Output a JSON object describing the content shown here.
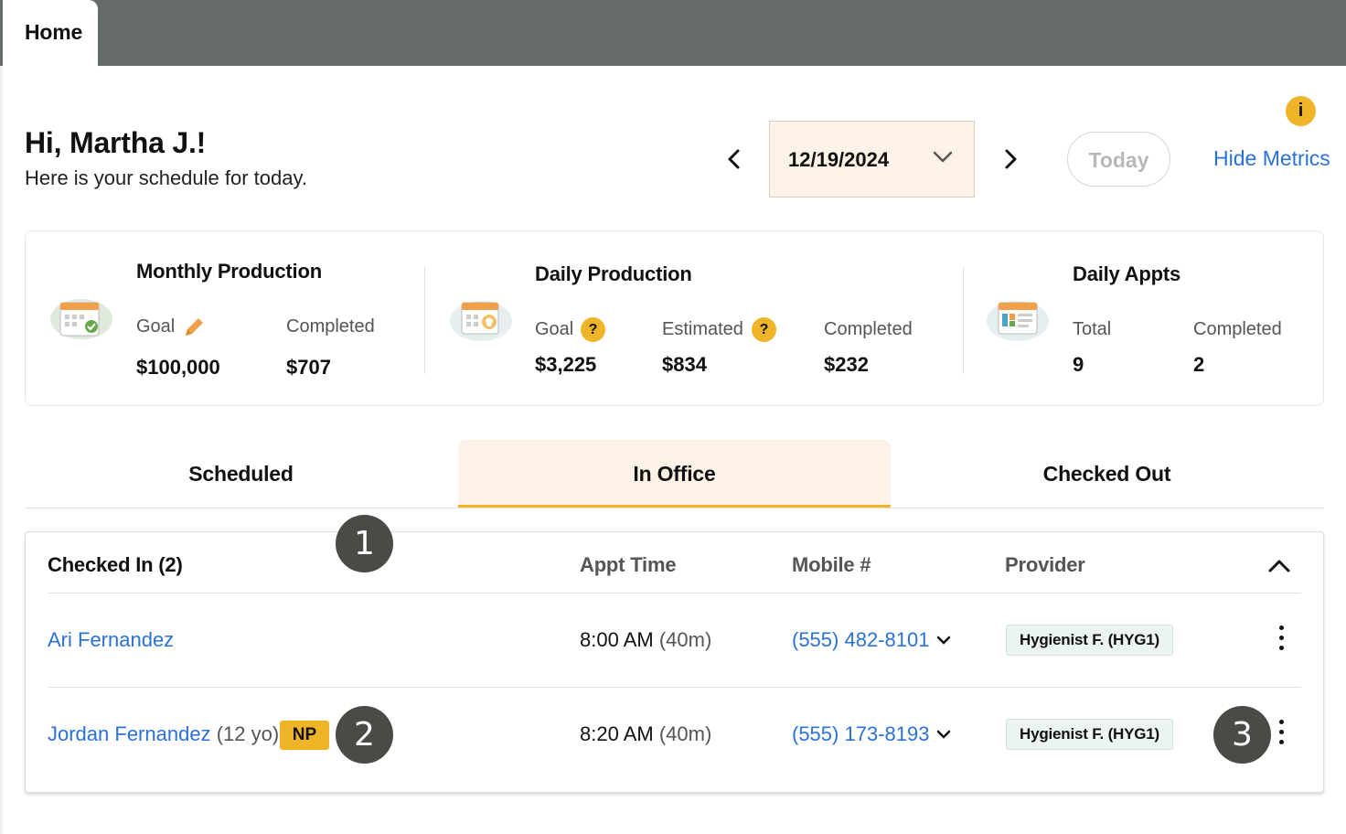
{
  "tabs": {
    "home": "Home"
  },
  "greeting": {
    "title": "Hi, Martha J.!",
    "subtitle": "Here is your schedule for today."
  },
  "date_nav": {
    "date": "12/19/2024",
    "today_label": "Today",
    "hide_metrics_label": "Hide Metrics",
    "info_glyph": "i"
  },
  "metrics": {
    "monthly": {
      "title": "Monthly Production",
      "goal_label": "Goal",
      "goal_value": "$100,000",
      "completed_label": "Completed",
      "completed_value": "$707"
    },
    "daily_production": {
      "title": "Daily Production",
      "goal_label": "Goal",
      "goal_value": "$3,225",
      "estimated_label": "Estimated",
      "estimated_value": "$834",
      "completed_label": "Completed",
      "completed_value": "$232",
      "help_glyph": "?"
    },
    "daily_appts": {
      "title": "Daily Appts",
      "total_label": "Total",
      "total_value": "9",
      "completed_label": "Completed",
      "completed_value": "2"
    }
  },
  "status_tabs": [
    "Scheduled",
    "In Office",
    "Checked Out"
  ],
  "table": {
    "group_label": "Checked In (2)",
    "headers": {
      "appt_time": "Appt Time",
      "mobile": "Mobile #",
      "provider": "Provider"
    },
    "rows": [
      {
        "name": "Ari Fernandez",
        "age": "",
        "badge": "",
        "time": "8:00 AM",
        "duration": "(40m)",
        "phone": "(555) 482-8101",
        "provider": "Hygienist F. (HYG1)"
      },
      {
        "name": "Jordan Fernandez",
        "age": "(12 yo)",
        "badge": "NP",
        "time": "8:20 AM",
        "duration": "(40m)",
        "phone": "(555) 173-8193",
        "provider": "Hygienist F. (HYG1)"
      }
    ]
  },
  "callouts": [
    "1",
    "2",
    "3"
  ],
  "colors": {
    "accent": "#f0b429",
    "link": "#2a72d8",
    "tab_active_bg": "#fdf2e8",
    "topbar": "#656a6a",
    "callout": "#4b4a47"
  }
}
